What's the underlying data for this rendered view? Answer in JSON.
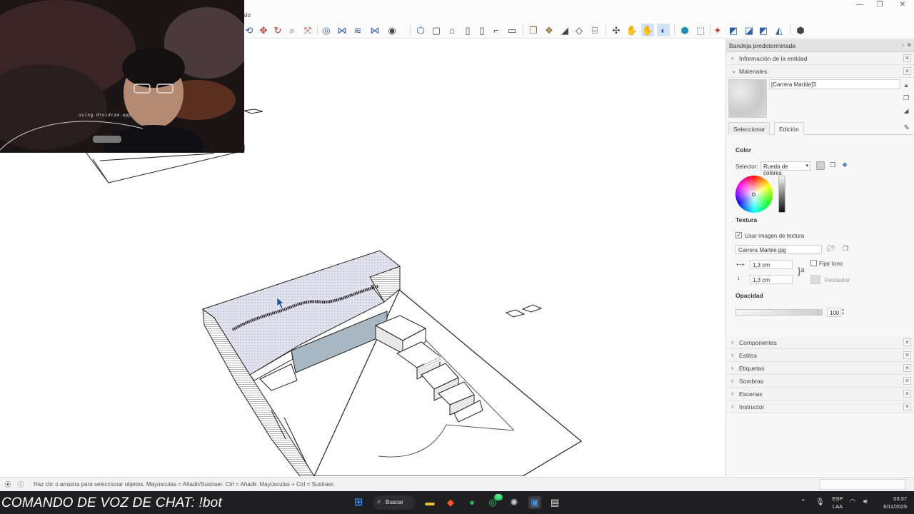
{
  "app": {
    "title_fragment": "do",
    "window_controls": [
      "—",
      "❐",
      "✕"
    ]
  },
  "toolbar": {
    "icons": [
      "select-icon",
      "move-icon",
      "rotate-icon",
      "zoom-icon",
      "zoom-extents-icon",
      "section-plane-icon",
      "solid-tools-icon",
      "outer-shell-icon",
      "camera-icon",
      "views-iso-icon",
      "views-top-icon",
      "views-front-icon",
      "views-right-icon",
      "views-back-icon",
      "views-left-icon",
      "views-bottom-icon",
      "components-icon",
      "sandbox-icon",
      "tape-icon",
      "dimensions-icon",
      "layout-icon",
      "orbit-icon",
      "pan-icon",
      "walk-icon",
      "look-around-icon",
      "extension-warehouse-icon",
      "styles-icon",
      "paint-icon",
      "shadow-icon",
      "fog-icon",
      "xray-icon",
      "settings-icon"
    ]
  },
  "webcam": {
    "caption": "using droidcam.app"
  },
  "tray": {
    "title": "Bandeja predeterminada",
    "entity_info_label": "Información de la entidad",
    "materials_label": "Materiales",
    "material_name": "[Carrera Marble]3",
    "tabs": [
      "Seleccionar",
      "Edición"
    ],
    "active_tab": "Edición",
    "color_heading": "Color",
    "selector_label": "Selector:",
    "selector_value": "Rueda de colores",
    "texture_heading": "Textura",
    "use_texture_label": "Usar imagen de textura",
    "use_texture_checked": true,
    "texture_file": "Carrera Marble.jpg",
    "width_value": "1,3 cm",
    "height_value": "1,3 cm",
    "fix_tone_label": "Fijar tono",
    "restore_label": "Restaurar",
    "opacity_heading": "Opacidad",
    "opacity_value": "100",
    "sections": [
      "Componentes",
      "Estilos",
      "Etiquetas",
      "Sombras",
      "Escenas",
      "Instructor"
    ]
  },
  "status": {
    "hint": "Haz clic o arrastra para seleccionar objetos. Mayúsculas = Añadir/Sustraer. Ctrl = Añadir. Mayúsculas + Ctrl = Sustraer."
  },
  "taskbar": {
    "chat_command": "COMANDO DE VOZ DE CHAT: !bot",
    "search_label": "Buscar",
    "whatsapp_badge": "32",
    "lang_top": "ESP",
    "lang_bottom": "LAA",
    "time": "03:37",
    "date": "6/11/2025"
  },
  "colors": {
    "accent": "#2f5fa8",
    "selected_face": "#e3e3f0",
    "pool_wall": "#a9b7c2"
  }
}
